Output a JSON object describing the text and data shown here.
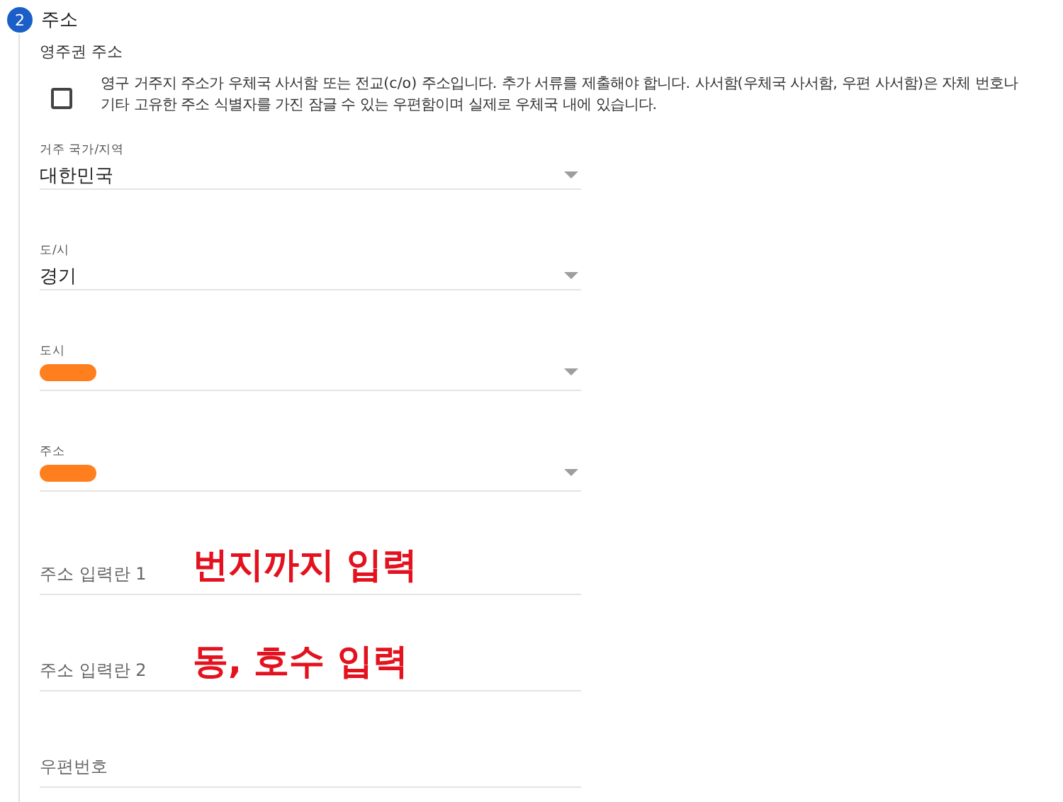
{
  "step": {
    "number": "2",
    "title": "주소"
  },
  "section_label": "영주권 주소",
  "po_box": {
    "checked": false,
    "text": "영구 거주지 주소가 우체국 사서함 또는 전교(c/o) 주소입니다. 추가 서류를 제출해야 합니다. 사서함(우체국 사서함, 우편 사서함)은 자체 번호나 기타 고유한 주소 식별자를 가진 잠글 수 있는 우편함이며 실제로 우체국 내에 있습니다."
  },
  "fields": [
    {
      "kind": "select",
      "label": "거주 국가/지역",
      "value": "대한민국",
      "redacted": false
    },
    {
      "kind": "select",
      "label": "도/시",
      "value": "경기",
      "redacted": false
    },
    {
      "kind": "select",
      "label": "도시",
      "redacted": true
    },
    {
      "kind": "select",
      "label": "주소",
      "redacted": true
    },
    {
      "kind": "input",
      "placeholder": "주소 입력란 1",
      "annotation": "번지까지 입력"
    },
    {
      "kind": "input",
      "placeholder": "주소 입력란 2",
      "annotation": "동, 호수 입력"
    },
    {
      "kind": "input",
      "placeholder": "우편번호"
    }
  ]
}
